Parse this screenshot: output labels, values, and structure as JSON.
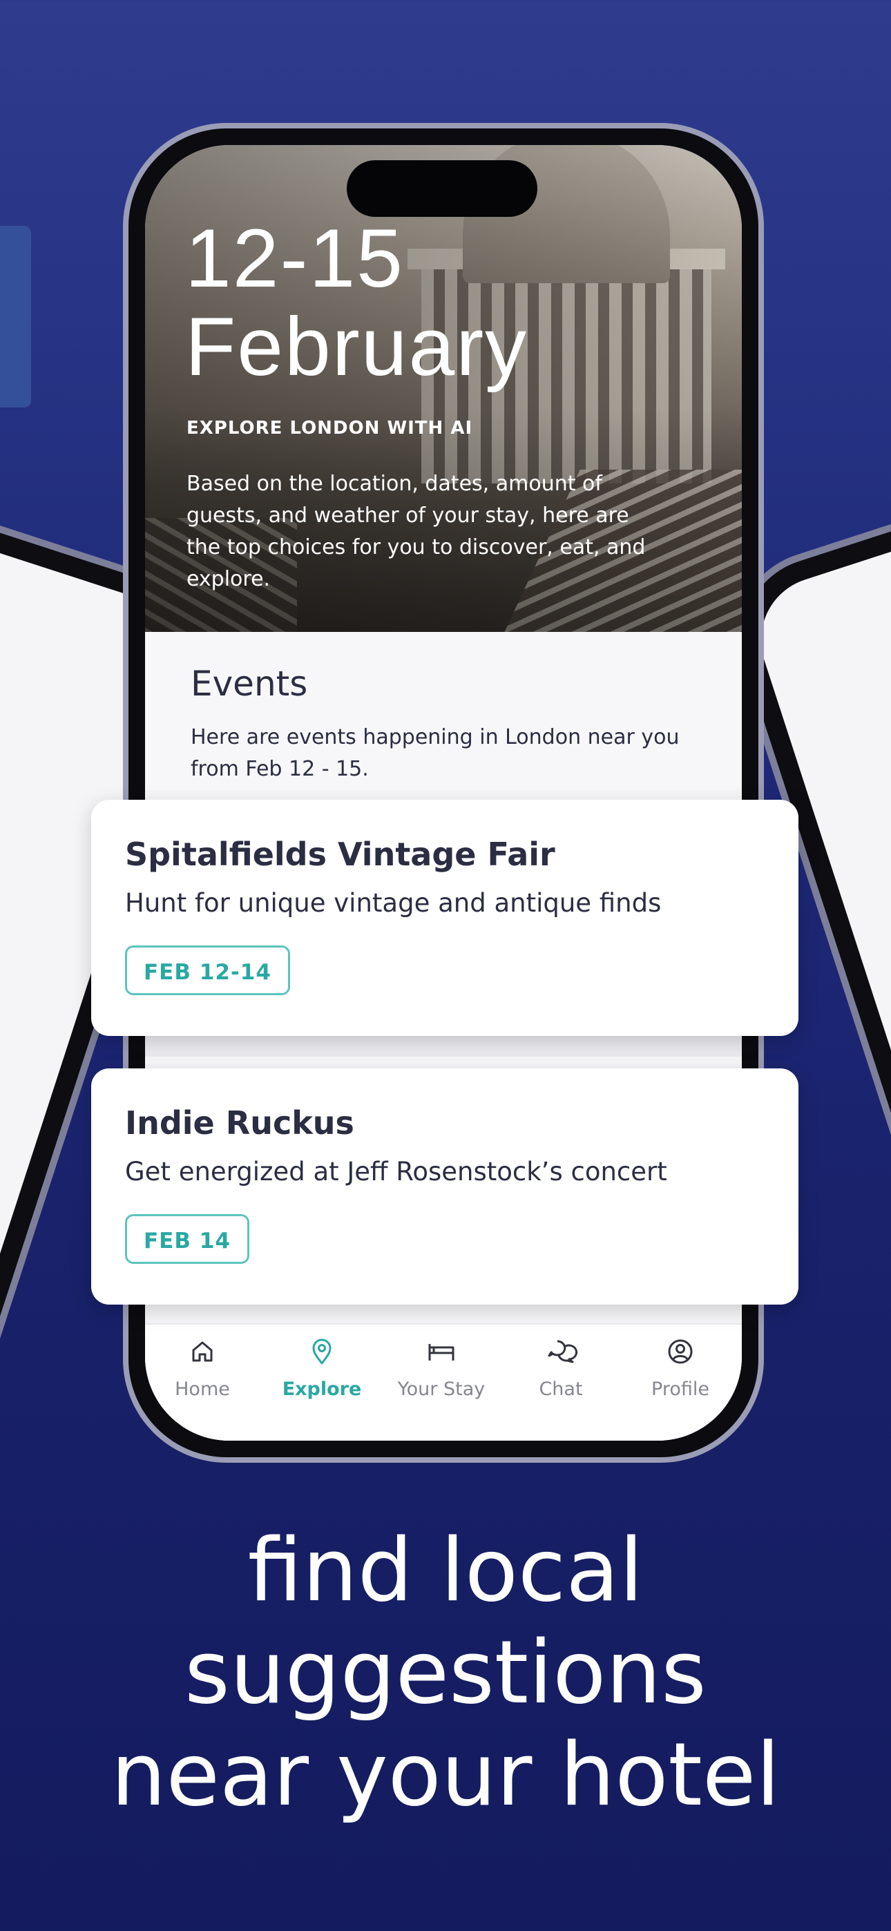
{
  "hero": {
    "date_line1": "12-15",
    "date_line2": "February",
    "eyebrow": "EXPLORE LONDON WITH AI",
    "description": "Based on the location, dates, amount of guests, and weather of your stay, here are the top choices for you to discover, eat, and explore."
  },
  "events": {
    "title": "Events",
    "subtitle": "Here are events happening in London near you from Feb 12 - 15.",
    "cards": [
      {
        "title": "Spitalfields Vintage Fair",
        "description": "Hunt for unique vintage and antique finds",
        "date": "FEB 12-14"
      },
      {
        "title": "Indie Ruckus",
        "description": "Get energized at Jeff Rosenstock’s concert",
        "date": "FEB 14"
      }
    ]
  },
  "nav": {
    "items": [
      {
        "label": "Home",
        "icon": "home-icon",
        "active": false
      },
      {
        "label": "Explore",
        "icon": "map-pin-icon",
        "active": true
      },
      {
        "label": "Your Stay",
        "icon": "bed-icon",
        "active": false
      },
      {
        "label": "Chat",
        "icon": "chat-bubbles-icon",
        "active": false
      },
      {
        "label": "Profile",
        "icon": "user-circle-icon",
        "active": false
      }
    ]
  },
  "tagline": {
    "line1": "find local",
    "line2": "suggestions",
    "line3": "near your hotel"
  },
  "colors": {
    "background": "#1f2a7a",
    "accent": "#2aa8a3",
    "text_dark": "#2b2d42",
    "nav_inactive": "#85868f"
  }
}
